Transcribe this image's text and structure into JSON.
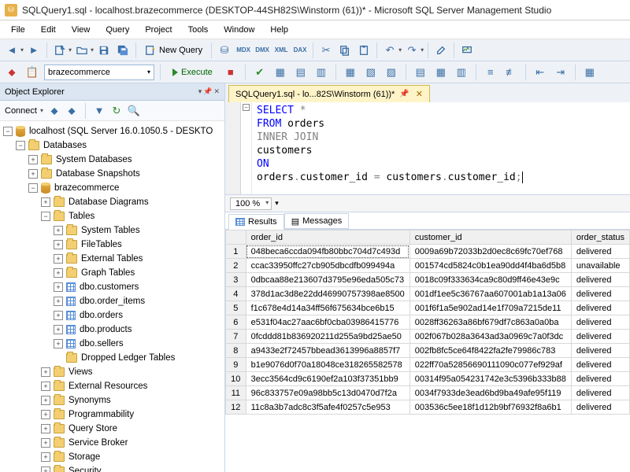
{
  "titlebar": {
    "text": "SQLQuery1.sql - localhost.brazecommerce (DESKTOP-44SH82S\\Winstorm (61))* - Microsoft SQL Server Management Studio"
  },
  "menu": [
    "File",
    "Edit",
    "View",
    "Query",
    "Project",
    "Tools",
    "Window",
    "Help"
  ],
  "toolbar": {
    "new_query": "New Query"
  },
  "execbar": {
    "database": "brazecommerce",
    "execute": "Execute"
  },
  "objectExplorer": {
    "title": "Object Explorer",
    "connect": "Connect",
    "root": "localhost (SQL Server 16.0.1050.5 - DESKTO",
    "databases": "Databases",
    "sysdb": "System Databases",
    "snapshots": "Database Snapshots",
    "userdb": "brazecommerce",
    "diagrams": "Database Diagrams",
    "tables": "Tables",
    "systables": "System Tables",
    "filetables": "FileTables",
    "exttables": "External Tables",
    "graphtables": "Graph Tables",
    "tbl_customers": "dbo.customers",
    "tbl_order_items": "dbo.order_items",
    "tbl_orders": "dbo.orders",
    "tbl_products": "dbo.products",
    "tbl_sellers": "dbo.sellers",
    "dropped": "Dropped Ledger Tables",
    "views": "Views",
    "extres": "External Resources",
    "synonyms": "Synonyms",
    "programmability": "Programmability",
    "querystore": "Query Store",
    "servicebroker": "Service Broker",
    "storage": "Storage",
    "security": "Security"
  },
  "tab": {
    "label": "SQLQuery1.sql - lo...82S\\Winstorm (61))*"
  },
  "code": {
    "l1a": "SELECT",
    "l1b": " *",
    "l2a": "FROM",
    "l2b": " orders",
    "l3": "INNER JOIN",
    "l4": "customers",
    "l5": "ON",
    "l6a": "orders",
    "l6b": "customer_id ",
    "l6c": " customers",
    "l6d": "customer_id"
  },
  "zoom": "100 %",
  "resultTabs": {
    "results": "Results",
    "messages": "Messages"
  },
  "columns": [
    "order_id",
    "customer_id",
    "order_status"
  ],
  "rows": [
    [
      "048beca6ccda094fb80bbc704d7c493d",
      "0009a69b72033b2d0ec8c69fc70ef768",
      "delivered"
    ],
    [
      "ccac33950ffc27cb905dbcdfb099494a",
      "001574cd5824c0b1ea90dd4f4ba6d5b8",
      "unavailable"
    ],
    [
      "0dbcaa88e213607d3795e96eda505c73",
      "0018c09f333634ca9c80d9ff46e43e9c",
      "delivered"
    ],
    [
      "378d1ac3d8e22dd46990757398ae8500",
      "001df1ee5c36767aa607001ab1a13a06",
      "delivered"
    ],
    [
      "f1c678e4d14a34ff56f675634bce6b15",
      "001f6f1a5e902ad14e1f709a7215de11",
      "delivered"
    ],
    [
      "e531f04ac27aac6bf0cba03986415776",
      "0028ff36263a86bf679df7c863a0a0ba",
      "delivered"
    ],
    [
      "0fcddd81b836920211d255a9bd25ae50",
      "002f067b028a3643ad3a0969c7a0f3dc",
      "delivered"
    ],
    [
      "a9433e2f72457bbead3613996a8857f7",
      "002fb8fc5ce64f8422fa2fe79986c783",
      "delivered"
    ],
    [
      "b1e9076d0f70a18048ce318265582578",
      "022ff70a52856690111090c077ef929af",
      "delivered"
    ],
    [
      "3ecc3564cd9c6190ef2a103f37351bb9",
      "00314f95a054231742e3c5396b333b88",
      "delivered"
    ],
    [
      "96c833757e09a98bb5c13d0470d7f2a",
      "0034f7933de3ead6bd9ba49afe95f119",
      "delivered"
    ],
    [
      "11c8a3b7adc8c3f5afe4f0257c5e953",
      "003536c5ee18f1d12b9bf76932f8a6b1",
      "delivered"
    ]
  ]
}
